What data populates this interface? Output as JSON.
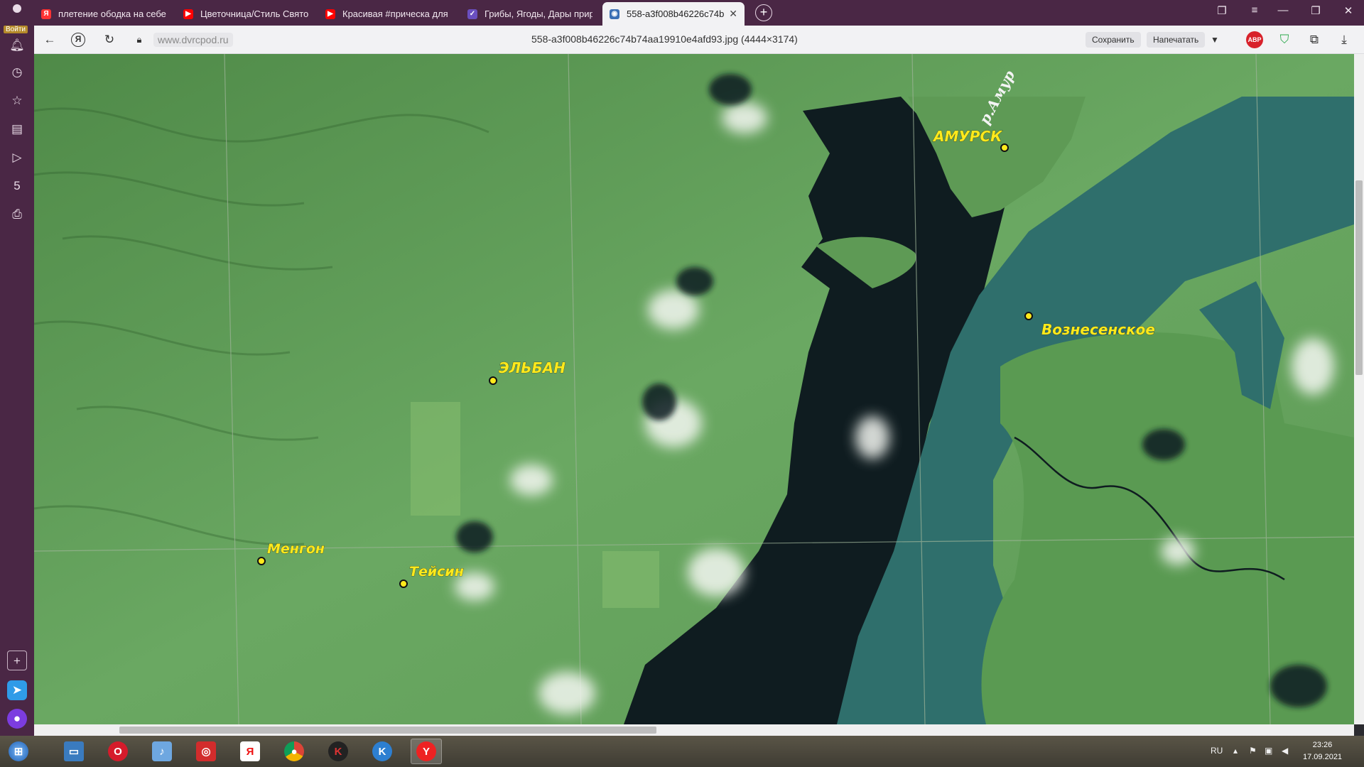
{
  "tabs": [
    {
      "label": "плетение ободка на себе",
      "icon": "yandex-icon"
    },
    {
      "label": "Цветочница/Стиль Свято",
      "icon": "youtube-icon"
    },
    {
      "label": "Красивая #прическа для",
      "icon": "youtube-icon"
    },
    {
      "label": "Грибы, Ягоды, Дары прир",
      "icon": "site-icon"
    },
    {
      "label": "558-a3f008b46226c74b",
      "icon": "image-icon",
      "active": true
    }
  ],
  "sidebar": {
    "login_label": "Войти"
  },
  "omnibox": {
    "url": "www.dvrcpod.ru",
    "title": "558-a3f008b46226c74b74aa19910e4afd93.jpg (4444×3174)",
    "save_label": "Сохранить",
    "print_label": "Напечатать",
    "abp_label": "ABP"
  },
  "map": {
    "labels": {
      "amursk": "АМУРСК",
      "amur_river": "р.Амур",
      "voznesenskoe": "Вознесенское",
      "elban": "ЭЛЬБАН",
      "mengon": "Менгон",
      "teysin": "Тейсин"
    },
    "colors": {
      "land": "#5e9a55",
      "water_dark": "#0e1a1f",
      "water_river": "#2f6f6c",
      "label": "#ffea1c"
    }
  },
  "taskbar": {
    "lang": "RU",
    "time": "23:26",
    "date": "17.09.2021",
    "yandex_label": "Я"
  }
}
